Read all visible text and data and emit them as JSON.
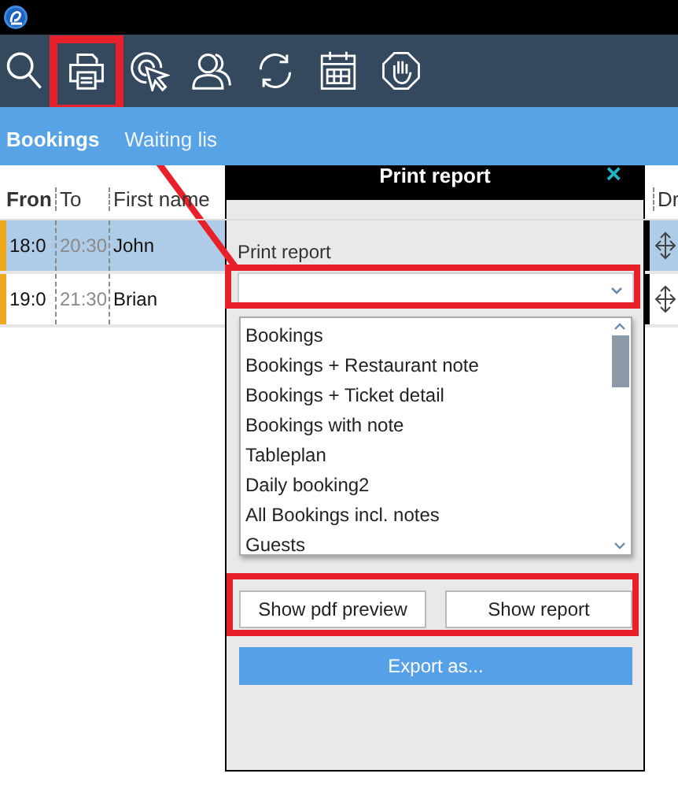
{
  "toolbar": {
    "tools": [
      {
        "kind": "search"
      },
      {
        "kind": "printer",
        "highlighted": true
      },
      {
        "kind": "pointer"
      },
      {
        "kind": "guests"
      },
      {
        "kind": "refresh"
      },
      {
        "kind": "calendar"
      },
      {
        "kind": "stop"
      }
    ]
  },
  "tabs": [
    {
      "label": "Bookings",
      "selected": true
    },
    {
      "label": "Waiting lis",
      "selected": false
    }
  ],
  "table": {
    "columns": [
      "Fron",
      "To",
      "First name",
      "Dr"
    ],
    "rows": [
      {
        "from": "18:0",
        "to": "20:30",
        "first_name": "John",
        "selected": true,
        "color": "#f0a81c"
      },
      {
        "from": "19:0",
        "to": "21:30",
        "first_name": "Brian",
        "selected": false,
        "color": "#f0a81c"
      }
    ]
  },
  "dialog": {
    "title": "Print report",
    "close": "×",
    "field_label": "Print report",
    "field_highlighted": true,
    "options": [
      "Bookings",
      "Bookings + Restaurant note",
      "Bookings + Ticket detail",
      "Bookings with note",
      "Tableplan",
      "Daily booking2",
      "All Bookings incl. notes",
      "Guests"
    ],
    "buttons": [
      "Show pdf preview",
      "Show report"
    ],
    "buttons_highlighted": true,
    "export_button": "Export as..."
  }
}
